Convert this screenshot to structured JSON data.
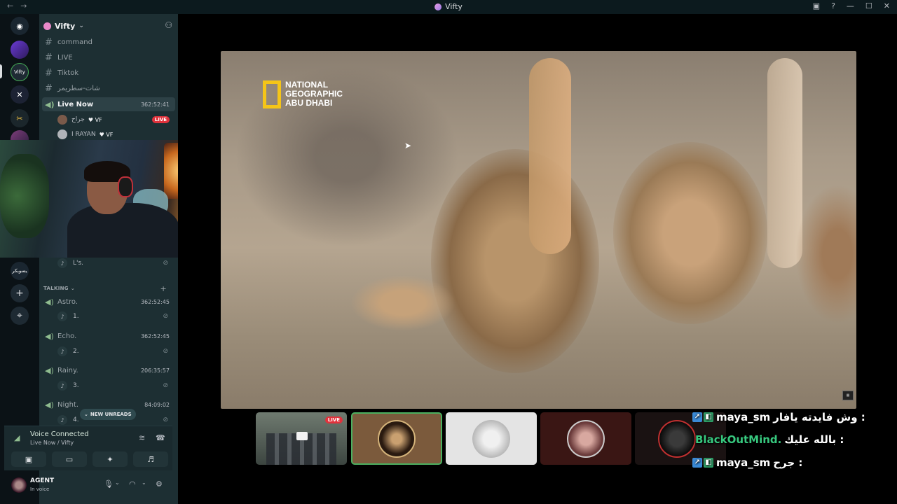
{
  "window": {
    "title": "Vifty",
    "nav": [
      "←",
      "→"
    ],
    "controls": [
      "▣",
      "?",
      "—",
      "☐",
      "✕"
    ]
  },
  "rail": {
    "servers": [
      "discord",
      "server-a",
      "Vifty",
      "server-b",
      "server-c",
      "server-d",
      "يسوبكر"
    ],
    "add_label": "+",
    "explore_label": "⌖"
  },
  "guild": {
    "name": "Vifty"
  },
  "channels": [
    {
      "name": "command",
      "type": "text"
    },
    {
      "name": "LIVE",
      "type": "text"
    },
    {
      "name": "Tiktok",
      "type": "text"
    },
    {
      "name": "شات-سطريمر",
      "type": "text"
    }
  ],
  "live_channel": {
    "name": "Live Now",
    "duration": "362:52:41",
    "members": [
      {
        "name": "جراح",
        "badge": "VF",
        "live": "LIVE"
      },
      {
        "name": "I RAYAN",
        "badge": "VF"
      }
    ]
  },
  "above_category_item": {
    "label": "L's."
  },
  "category": {
    "name": "TALKING"
  },
  "voice_channels": [
    {
      "name": "Astro.",
      "duration": "362:52:45",
      "sub": "1."
    },
    {
      "name": "Echo.",
      "duration": "362:52:45",
      "sub": "2."
    },
    {
      "name": "Rainy.",
      "duration": "206:35:57",
      "sub": "3."
    },
    {
      "name": "Night.",
      "duration": "84:09:02",
      "sub": "4."
    }
  ],
  "new_unreads": "NEW UNREADS",
  "voice_panel": {
    "status": "Voice Connected",
    "location": "Live Now / Vifty"
  },
  "user": {
    "name": "AGENT",
    "status": "In voice"
  },
  "stream": {
    "logo_lines": [
      "NATIONAL",
      "GEOGRAPHIC",
      "ABU DHABI"
    ],
    "live_label": "LIVE"
  },
  "chat": [
    {
      "name": "maya_sm",
      "message": "وش فايدته يافار :",
      "name_color": "#ffffff"
    },
    {
      "name": "BlackOutMind.",
      "message": "بالله عليك :",
      "name_color": "#37c97f"
    },
    {
      "name": "maya_sm",
      "message": "جرح :",
      "name_color": "#ffffff"
    }
  ]
}
